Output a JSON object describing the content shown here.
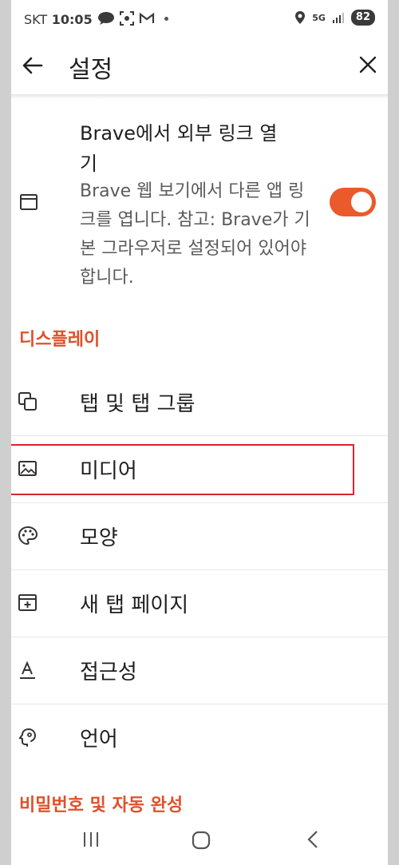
{
  "status_bar": {
    "carrier": "SKT",
    "time": "10:05",
    "network": "5G",
    "battery": "82"
  },
  "app_bar": {
    "title": "설정",
    "back_icon": "arrow-left-icon",
    "close_icon": "close-icon"
  },
  "external_links": {
    "title": "Brave에서 외부 링크 열기",
    "summary": "Brave 웹 보기에서 다른 앱 링크를 엽니다. 참고: Brave가 기본 그라우저로 설정되어 있어야 합니다.",
    "toggle_on": true,
    "accent_color": "#ea5a2a"
  },
  "display_section": {
    "header": "디스플레이",
    "items": [
      {
        "label": "탭 및 탭 그룹",
        "icon": "tabs-icon"
      },
      {
        "label": "미디어",
        "icon": "image-icon"
      },
      {
        "label": "모양",
        "icon": "palette-icon"
      },
      {
        "label": "새 탭 페이지",
        "icon": "new-tab-icon"
      },
      {
        "label": "접근성",
        "icon": "text-format-icon"
      },
      {
        "label": "언어",
        "icon": "language-icon"
      }
    ]
  },
  "password_section": {
    "header": "비밀번호 및 자동 완성"
  },
  "highlighted_item": "미디어",
  "highlight_color": "#d8262e"
}
